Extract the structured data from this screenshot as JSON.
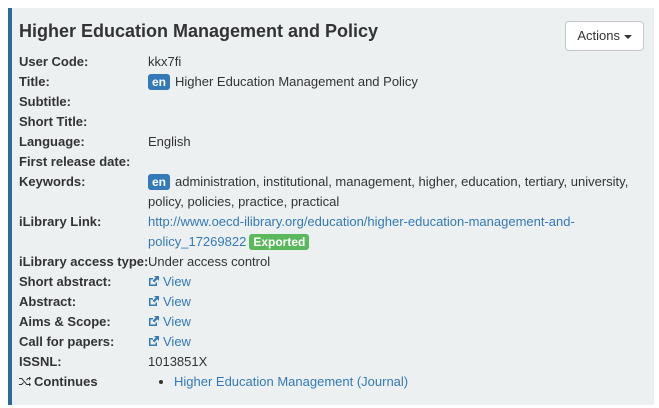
{
  "title": "Higher Education Management and Policy",
  "actions_label": "Actions",
  "fields": {
    "user_code": {
      "label": "User Code:",
      "value": "kkx7fi"
    },
    "title": {
      "label": "Title:",
      "lang": "en",
      "value": "Higher Education Management and Policy"
    },
    "subtitle": {
      "label": "Subtitle:"
    },
    "short_title": {
      "label": "Short Title:"
    },
    "language": {
      "label": "Language:",
      "value": "English"
    },
    "first_release": {
      "label": "First release date:"
    },
    "keywords": {
      "label": "Keywords:",
      "lang": "en",
      "value": "administration, institutional, management, higher, education, tertiary, university, policy, policies, practice, practical"
    },
    "ilibrary_link": {
      "label": "iLibrary Link:",
      "url": "http://www.oecd-ilibrary.org/education/higher-education-management-and-policy_17269822",
      "status": "Exported"
    },
    "access_type": {
      "label": "iLibrary access type:",
      "value": "Under access control"
    },
    "short_abstract": {
      "label": "Short abstract:",
      "link": "View"
    },
    "abstract": {
      "label": "Abstract:",
      "link": "View"
    },
    "aims_scope": {
      "label": "Aims & Scope:",
      "link": "View"
    },
    "call_papers": {
      "label": "Call for papers:",
      "link": "View"
    },
    "issnl": {
      "label": "ISSNL:",
      "value": "1013851X"
    },
    "continues": {
      "label": "Continues",
      "items": [
        "Higher Education Management (Journal)"
      ]
    }
  },
  "colors": {
    "accent": "#337ab7",
    "border": "#2c6a9a",
    "exported": "#5cb85c",
    "panel": "#ecf0f1"
  },
  "icons": {
    "external": "external-link-icon",
    "continues": "shuffle-icon",
    "dropdown": "caret-down-icon"
  }
}
